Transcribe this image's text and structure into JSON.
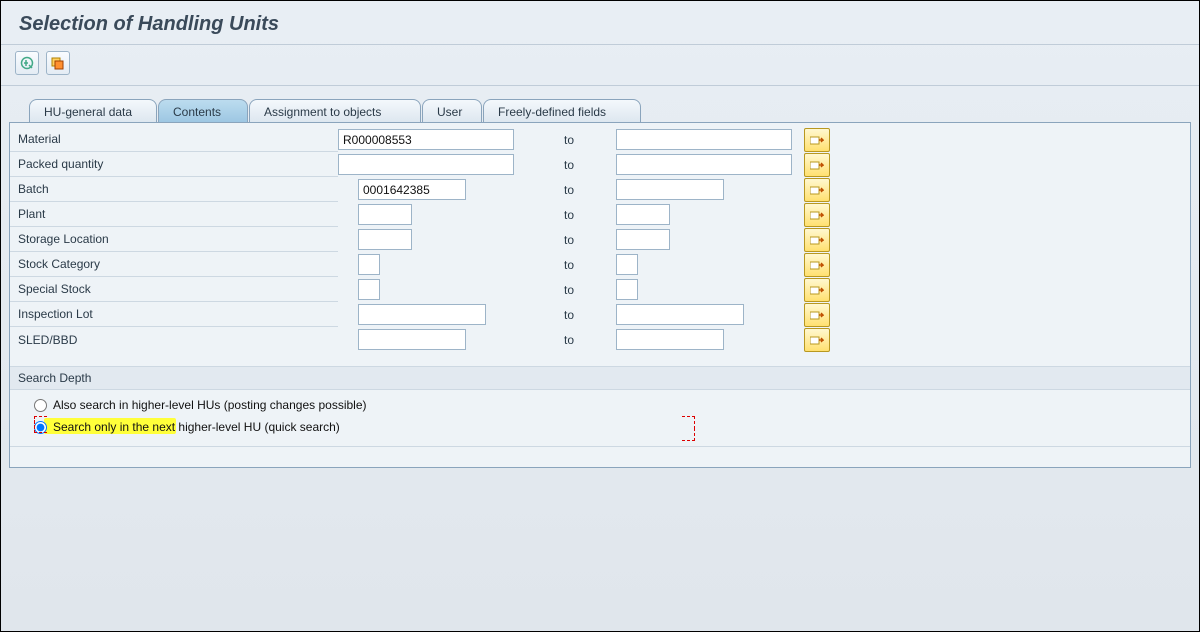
{
  "header": {
    "title": "Selection of Handling Units"
  },
  "tabs": {
    "t1": "HU-general data",
    "t2": "Contents",
    "t3": "Assignment to objects",
    "t4": "User",
    "t5": "Freely-defined fields"
  },
  "fields": {
    "material": {
      "label": "Material",
      "from": "R000008553",
      "to_label": "to",
      "high": ""
    },
    "packed_qty": {
      "label": "Packed quantity",
      "from": "",
      "to_label": "to",
      "high": ""
    },
    "batch": {
      "label": "Batch",
      "from": "0001642385",
      "to_label": "to",
      "high": ""
    },
    "plant": {
      "label": "Plant",
      "from": "",
      "to_label": "to",
      "high": ""
    },
    "storage_loc": {
      "label": "Storage Location",
      "from": "",
      "to_label": "to",
      "high": ""
    },
    "stock_category": {
      "label": "Stock Category",
      "from": "",
      "to_label": "to",
      "high": ""
    },
    "special_stock": {
      "label": "Special Stock",
      "from": "",
      "to_label": "to",
      "high": ""
    },
    "inspection_lot": {
      "label": "Inspection Lot",
      "from": "",
      "to_label": "to",
      "high": ""
    },
    "sled_bbd": {
      "label": "SLED/BBD",
      "from": "",
      "to_label": "to",
      "high": ""
    }
  },
  "search_depth": {
    "title": "Search Depth",
    "opt1": "Also search in higher-level HUs (posting changes possible)",
    "opt2": "Search only in the next higher-level HU (quick search)",
    "selected": "opt2"
  }
}
